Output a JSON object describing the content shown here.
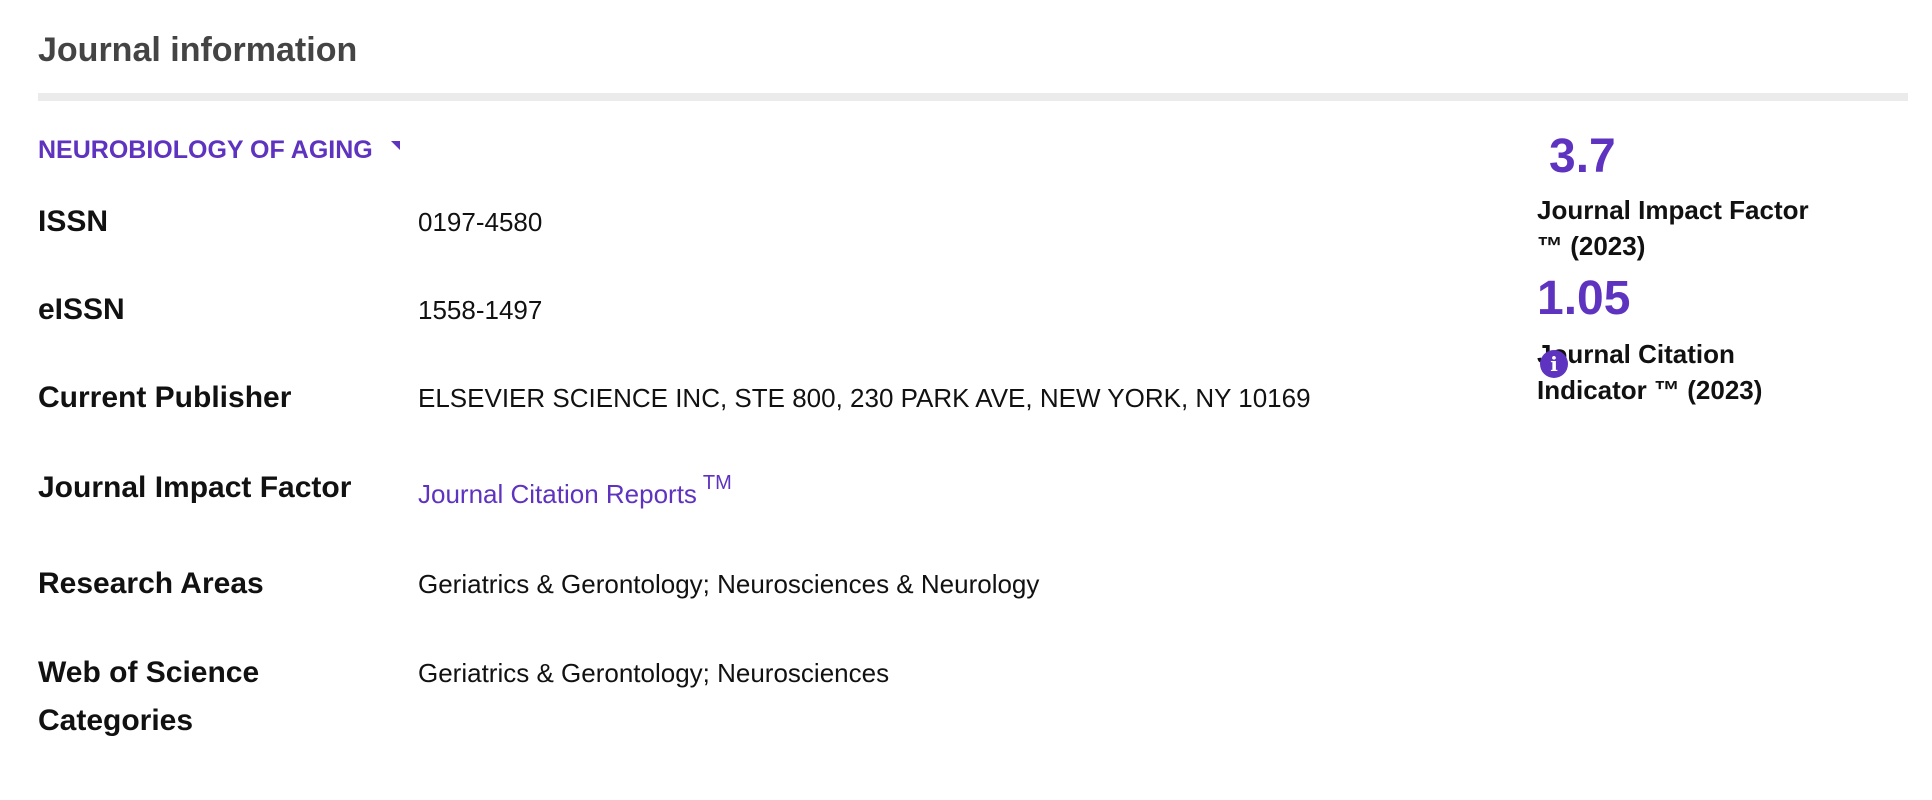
{
  "section": {
    "title": "Journal information"
  },
  "journal": {
    "name": "NEUROBIOLOGY OF AGING"
  },
  "fields": {
    "issn": {
      "label": "ISSN",
      "value": "0197-4580"
    },
    "eissn": {
      "label": "eISSN",
      "value": "1558-1497"
    },
    "publisher": {
      "label": "Current Publisher",
      "value": "ELSEVIER SCIENCE INC, STE 800, 230 PARK AVE, NEW YORK, NY 10169"
    },
    "impact_factor": {
      "label": "Journal Impact Factor",
      "link_text": "Journal Citation Reports",
      "link_suffix": "TM"
    },
    "research_areas": {
      "label": "Research Areas",
      "value": "Geriatrics & Gerontology; Neurosciences & Neurology"
    },
    "wos_categories": {
      "label_line1": "Web of Science",
      "label_line2": "Categories",
      "value": "Geriatrics & Gerontology; Neurosciences"
    }
  },
  "metrics": {
    "jif": {
      "value": "3.7",
      "label_line1": "Journal Impact Factor",
      "label_line2": "™ (2023)"
    },
    "jci": {
      "value": "1.05",
      "label_line1": "Journal Citation",
      "label_line2": "Indicator ™ (2023)",
      "info_icon": "i"
    }
  },
  "colors": {
    "accent": "#5e33bf",
    "heading": "#444444",
    "divider": "#ebebeb",
    "text": "#111111"
  },
  "icons": {
    "journal_link": "external-link-icon",
    "jci_info": "info-icon"
  }
}
